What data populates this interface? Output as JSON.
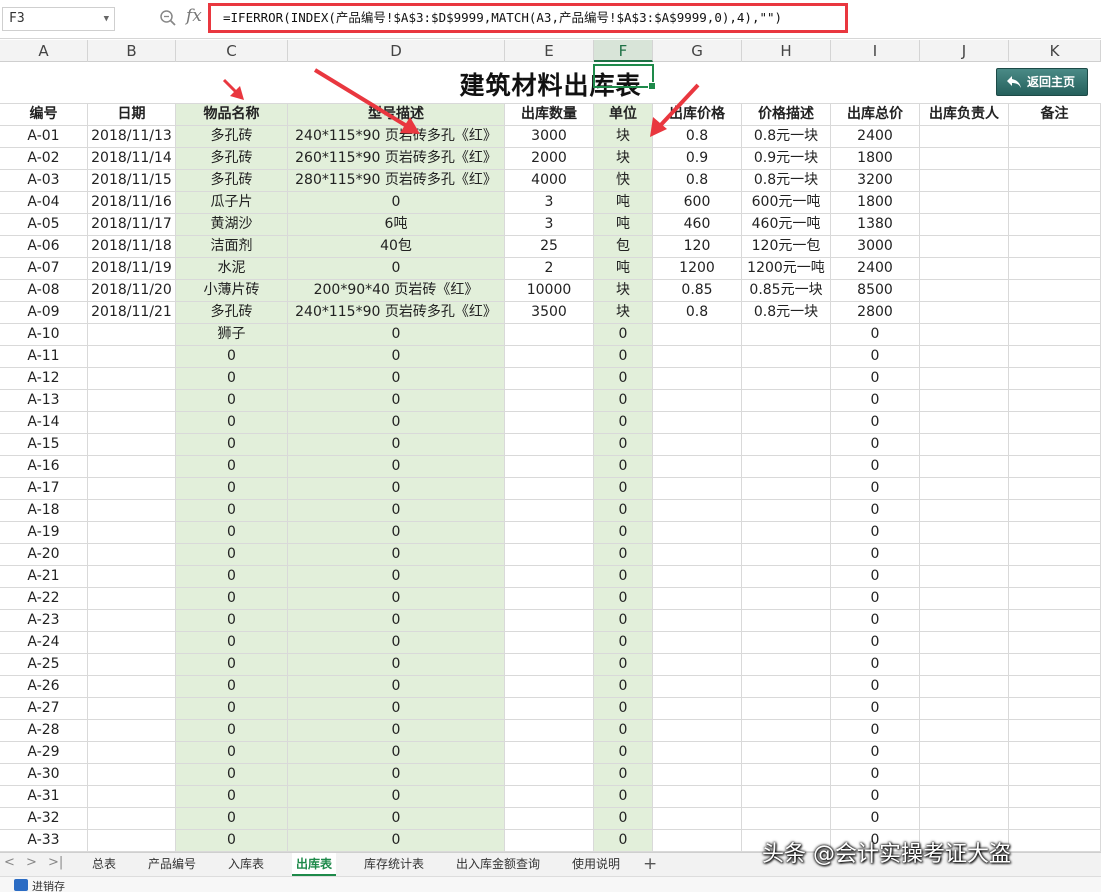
{
  "formula_bar": {
    "name_box": "F3",
    "fx_label": "fx",
    "formula": "=IFERROR(INDEX(产品编号!$A$3:$D$9999,MATCH(A3,产品编号!$A$3:$A$9999,0),4),\"\")"
  },
  "columns": [
    "A",
    "B",
    "C",
    "D",
    "E",
    "F",
    "G",
    "H",
    "I",
    "J",
    "K"
  ],
  "selected_column": "F",
  "sheet": {
    "title": "建筑材料出库表",
    "home_button": "返回主页",
    "headers": [
      "编号",
      "日期",
      "物品名称",
      "型号描述",
      "出库数量",
      "单位",
      "出库价格",
      "价格描述",
      "出库总价",
      "出库负责人",
      "备注"
    ],
    "rows": [
      [
        "A-01",
        "2018/11/13",
        "多孔砖",
        "240*115*90 页岩砖多孔《红》",
        "3000",
        "块",
        "0.8",
        "0.8元一块",
        "2400",
        "",
        ""
      ],
      [
        "A-02",
        "2018/11/14",
        "多孔砖",
        "260*115*90 页岩砖多孔《红》",
        "2000",
        "块",
        "0.9",
        "0.9元一块",
        "1800",
        "",
        ""
      ],
      [
        "A-03",
        "2018/11/15",
        "多孔砖",
        "280*115*90 页岩砖多孔《红》",
        "4000",
        "快",
        "0.8",
        "0.8元一块",
        "3200",
        "",
        ""
      ],
      [
        "A-04",
        "2018/11/16",
        "瓜子片",
        "0",
        "3",
        "吨",
        "600",
        "600元一吨",
        "1800",
        "",
        ""
      ],
      [
        "A-05",
        "2018/11/17",
        "黄湖沙",
        "6吨",
        "3",
        "吨",
        "460",
        "460元一吨",
        "1380",
        "",
        ""
      ],
      [
        "A-06",
        "2018/11/18",
        "洁面剂",
        "40包",
        "25",
        "包",
        "120",
        "120元一包",
        "3000",
        "",
        ""
      ],
      [
        "A-07",
        "2018/11/19",
        "水泥",
        "0",
        "2",
        "吨",
        "1200",
        "1200元一吨",
        "2400",
        "",
        ""
      ],
      [
        "A-08",
        "2018/11/20",
        "小薄片砖",
        "200*90*40 页岩砖《红》",
        "10000",
        "块",
        "0.85",
        "0.85元一块",
        "8500",
        "",
        ""
      ],
      [
        "A-09",
        "2018/11/21",
        "多孔砖",
        "240*115*90 页岩砖多孔《红》",
        "3500",
        "块",
        "0.8",
        "0.8元一块",
        "2800",
        "",
        ""
      ],
      [
        "A-10",
        "",
        "狮子",
        "0",
        "",
        "0",
        "",
        "",
        "0",
        "",
        ""
      ],
      [
        "A-11",
        "",
        "0",
        "0",
        "",
        "0",
        "",
        "",
        "0",
        "",
        ""
      ],
      [
        "A-12",
        "",
        "0",
        "0",
        "",
        "0",
        "",
        "",
        "0",
        "",
        ""
      ],
      [
        "A-13",
        "",
        "0",
        "0",
        "",
        "0",
        "",
        "",
        "0",
        "",
        ""
      ],
      [
        "A-14",
        "",
        "0",
        "0",
        "",
        "0",
        "",
        "",
        "0",
        "",
        ""
      ],
      [
        "A-15",
        "",
        "0",
        "0",
        "",
        "0",
        "",
        "",
        "0",
        "",
        ""
      ],
      [
        "A-16",
        "",
        "0",
        "0",
        "",
        "0",
        "",
        "",
        "0",
        "",
        ""
      ],
      [
        "A-17",
        "",
        "0",
        "0",
        "",
        "0",
        "",
        "",
        "0",
        "",
        ""
      ],
      [
        "A-18",
        "",
        "0",
        "0",
        "",
        "0",
        "",
        "",
        "0",
        "",
        ""
      ],
      [
        "A-19",
        "",
        "0",
        "0",
        "",
        "0",
        "",
        "",
        "0",
        "",
        ""
      ],
      [
        "A-20",
        "",
        "0",
        "0",
        "",
        "0",
        "",
        "",
        "0",
        "",
        ""
      ],
      [
        "A-21",
        "",
        "0",
        "0",
        "",
        "0",
        "",
        "",
        "0",
        "",
        ""
      ],
      [
        "A-22",
        "",
        "0",
        "0",
        "",
        "0",
        "",
        "",
        "0",
        "",
        ""
      ],
      [
        "A-23",
        "",
        "0",
        "0",
        "",
        "0",
        "",
        "",
        "0",
        "",
        ""
      ],
      [
        "A-24",
        "",
        "0",
        "0",
        "",
        "0",
        "",
        "",
        "0",
        "",
        ""
      ],
      [
        "A-25",
        "",
        "0",
        "0",
        "",
        "0",
        "",
        "",
        "0",
        "",
        ""
      ],
      [
        "A-26",
        "",
        "0",
        "0",
        "",
        "0",
        "",
        "",
        "0",
        "",
        ""
      ],
      [
        "A-27",
        "",
        "0",
        "0",
        "",
        "0",
        "",
        "",
        "0",
        "",
        ""
      ],
      [
        "A-28",
        "",
        "0",
        "0",
        "",
        "0",
        "",
        "",
        "0",
        "",
        ""
      ],
      [
        "A-29",
        "",
        "0",
        "0",
        "",
        "0",
        "",
        "",
        "0",
        "",
        ""
      ],
      [
        "A-30",
        "",
        "0",
        "0",
        "",
        "0",
        "",
        "",
        "0",
        "",
        ""
      ],
      [
        "A-31",
        "",
        "0",
        "0",
        "",
        "0",
        "",
        "",
        "0",
        "",
        ""
      ],
      [
        "A-32",
        "",
        "0",
        "0",
        "",
        "0",
        "",
        "",
        "0",
        "",
        ""
      ],
      [
        "A-33",
        "",
        "0",
        "0",
        "",
        "0",
        "",
        "",
        "0",
        "",
        ""
      ]
    ]
  },
  "tabs": [
    "总表",
    "产品编号",
    "入库表",
    "出库表",
    "库存统计表",
    "出入库金额查询",
    "使用说明"
  ],
  "active_tab": "出库表",
  "add_tab_glyph": "+",
  "watermark": "头条 @会计实操考证大盗",
  "status": {
    "text": "进销存"
  },
  "colors": {
    "accent": "#1e8a4a",
    "highlight_column": "#e2efda",
    "annotation_red": "#e9373f"
  }
}
